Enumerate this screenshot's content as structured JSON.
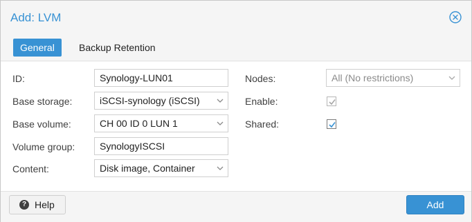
{
  "dialog": {
    "title": "Add: LVM",
    "close_icon": "close-icon"
  },
  "tabs": [
    {
      "label": "General",
      "active": true
    },
    {
      "label": "Backup Retention",
      "active": false
    }
  ],
  "form": {
    "id": {
      "label": "ID:",
      "value": "Synology-LUN01"
    },
    "base_storage": {
      "label": "Base storage:",
      "value": "iSCSI-synology (iSCSI)"
    },
    "base_volume": {
      "label": "Base volume:",
      "value": "CH 00 ID 0 LUN 1"
    },
    "volume_group": {
      "label": "Volume group:",
      "value": "SynologyISCSI"
    },
    "content": {
      "label": "Content:",
      "value": "Disk image, Container"
    },
    "nodes": {
      "label": "Nodes:",
      "value": "All (No restrictions)"
    },
    "enable": {
      "label": "Enable:",
      "checked": true,
      "disabled": true
    },
    "shared": {
      "label": "Shared:",
      "checked": true,
      "disabled": false
    }
  },
  "footer": {
    "help_label": "Help",
    "add_label": "Add"
  },
  "colors": {
    "accent": "#3892d4",
    "check_enabled": "#3892d4",
    "check_disabled": "#a8a8a8"
  }
}
